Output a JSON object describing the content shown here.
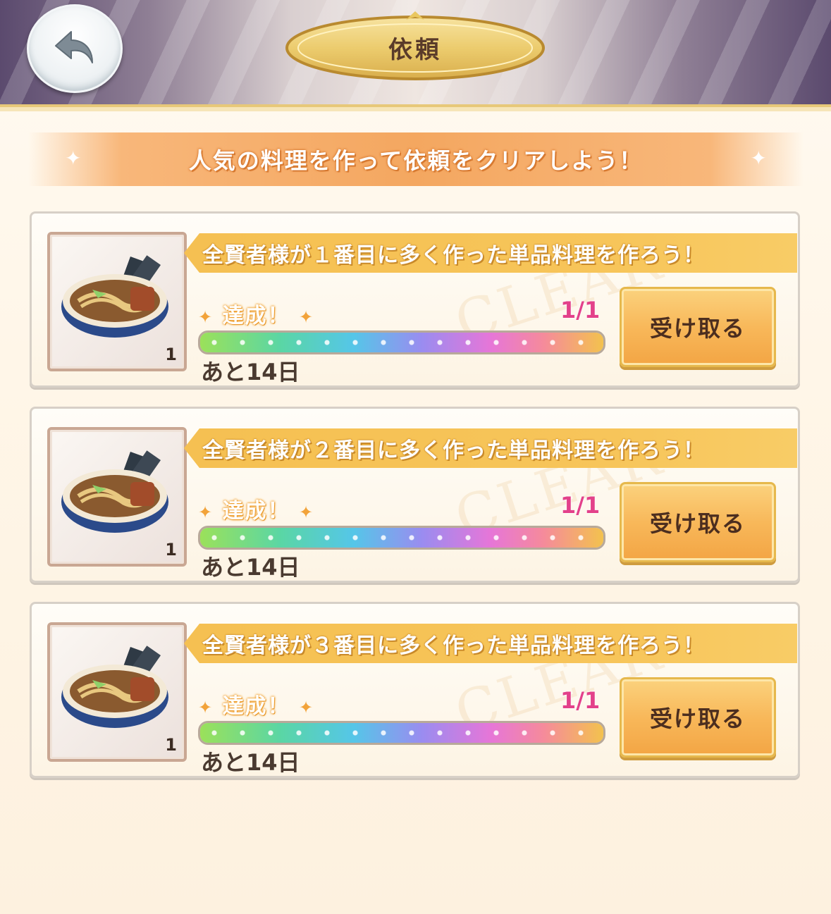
{
  "header": {
    "title": "依頼",
    "back_icon": "back-arrow-icon"
  },
  "banner": {
    "text": "人気の料理を作って依頼をクリアしよう！"
  },
  "requests": [
    {
      "description": "全賢者様が１番目に多く作った単品料理を作ろう！",
      "item_icon": "ramen-bowl-icon",
      "item_qty": "1",
      "status": "達成！",
      "progress_text": "1/1",
      "progress": 1.0,
      "remaining": "あと14日",
      "button": "受け取る"
    },
    {
      "description": "全賢者様が２番目に多く作った単品料理を作ろう！",
      "item_icon": "ramen-bowl-icon",
      "item_qty": "1",
      "status": "達成！",
      "progress_text": "1/1",
      "progress": 1.0,
      "remaining": "あと14日",
      "button": "受け取る"
    },
    {
      "description": "全賢者様が３番目に多く作った単品料理を作ろう！",
      "item_icon": "ramen-bowl-icon",
      "item_qty": "1",
      "status": "達成！",
      "progress_text": "1/1",
      "progress": 1.0,
      "remaining": "あと14日",
      "button": "受け取る"
    }
  ],
  "colors": {
    "accent_orange": "#f4a760",
    "progress_pink": "#e3418a",
    "button_orange": "#f8b85a"
  }
}
